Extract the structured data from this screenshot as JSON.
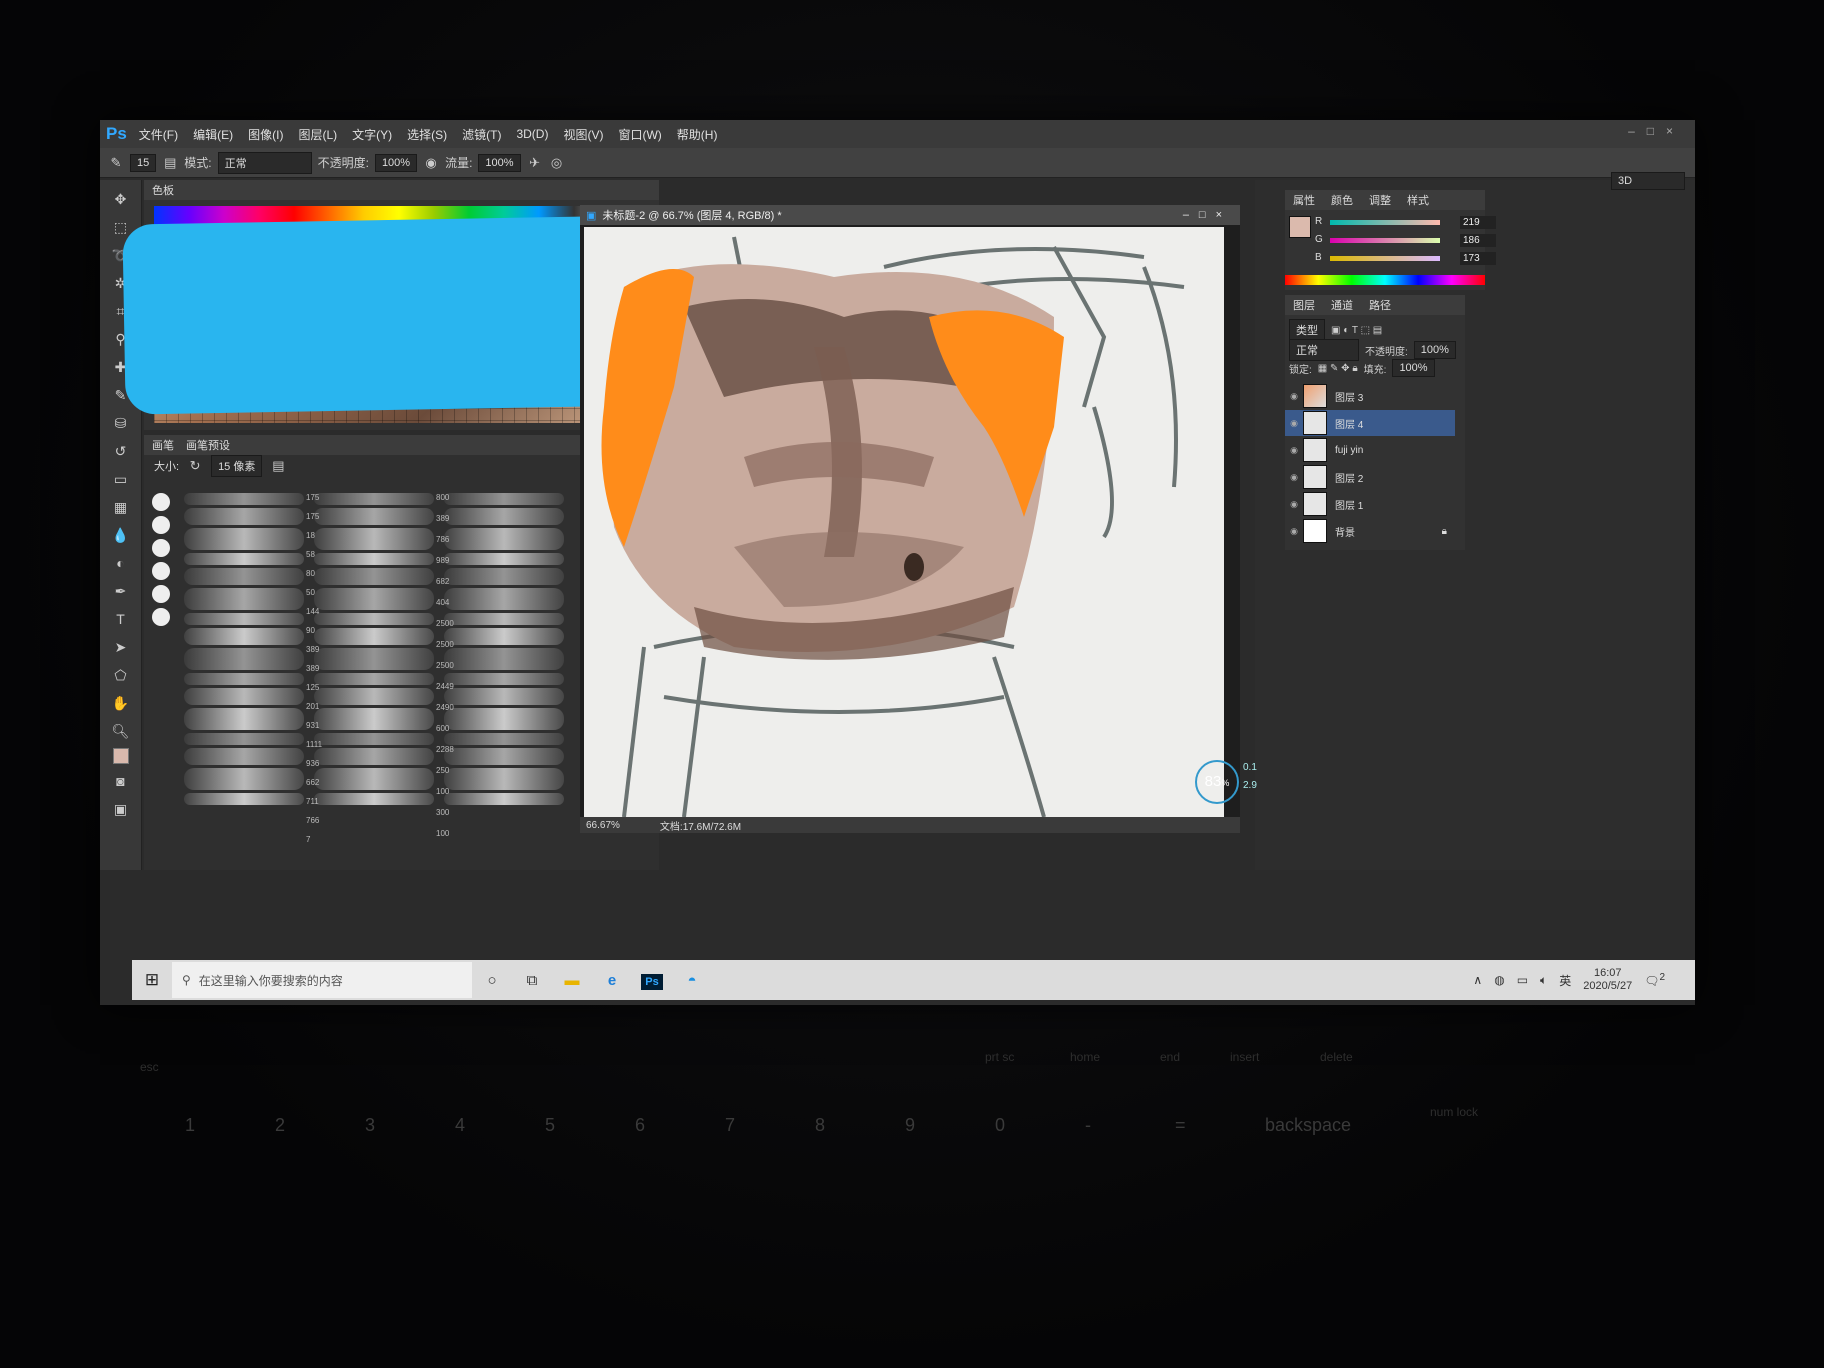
{
  "app": {
    "logo": "Ps",
    "menu": [
      "文件(F)",
      "编辑(E)",
      "图像(I)",
      "图层(L)",
      "文字(Y)",
      "选择(S)",
      "滤镜(T)",
      "3D(D)",
      "视图(V)",
      "窗口(W)",
      "帮助(H)"
    ]
  },
  "options": {
    "brush_size": "15",
    "mode_label": "模式:",
    "mode_value": "正常",
    "opacity_label": "不透明度:",
    "opacity_value": "100%",
    "flow_label": "流量:",
    "flow_value": "100%"
  },
  "swatches": {
    "tab": "色板"
  },
  "brushes": {
    "tab_brush": "画笔",
    "tab_presets": "画笔预设",
    "size_label": "大小:",
    "size_value": "15 像素",
    "col1_numbers": [
      "175",
      "175",
      "18",
      "58",
      "80",
      "50",
      "144",
      "90",
      "389",
      "389",
      "125",
      "201",
      "931",
      "1111",
      "936",
      "662",
      "711",
      "766",
      "7"
    ],
    "col2_numbers": [
      "800",
      "389",
      "786",
      "989",
      "682",
      "404",
      "2500",
      "2500",
      "2500",
      "2449",
      "2490",
      "600",
      "2288",
      "250",
      "100",
      "300",
      "100"
    ]
  },
  "document": {
    "title": "未标题-2 @ 66.7% (图层 4, RGB/8) *",
    "zoom": "66.67%",
    "doc_size": "文档:17.6M/72.6M"
  },
  "right_dock": {
    "workspace": "3D",
    "color_tabs": [
      "属性",
      "颜色",
      "调整",
      "样式"
    ],
    "r_label": "R",
    "r_value": "219",
    "g_label": "G",
    "g_value": "186",
    "b_label": "B",
    "b_value": "173",
    "layer_tabs": [
      "图层",
      "通道",
      "路径"
    ],
    "kind_label": "类型",
    "blend_mode": "正常",
    "opacity_label": "不透明度:",
    "opacity_value": "100%",
    "lock_label": "锁定:",
    "fill_label": "填充:",
    "fill_value": "100%",
    "layers": [
      "图层 3",
      "图层 4",
      "fuji yin",
      "图层 2",
      "图层 1",
      "背景"
    ]
  },
  "perf": {
    "percent": "83",
    "unit": "%",
    "up": "0.1",
    "down": "2.9"
  },
  "taskbar": {
    "search_placeholder": "在这里输入你要搜索的内容",
    "ime": "英",
    "time": "16:07",
    "date": "2020/5/27",
    "notif_count": "2"
  },
  "keyboard": {
    "fkeys": [
      "esc",
      "prt sc",
      "home",
      "end",
      "insert",
      "delete"
    ],
    "numrow": [
      "1",
      "2",
      "3",
      "4",
      "5",
      "6",
      "7",
      "8",
      "9",
      "0",
      "-",
      "=",
      "backspace"
    ],
    "numlock": "num lock"
  },
  "colors": {
    "accent": "#31a8ff",
    "redact": "#29b5ef",
    "orange": "#ff8c1a",
    "fg": "#dbbaad"
  }
}
